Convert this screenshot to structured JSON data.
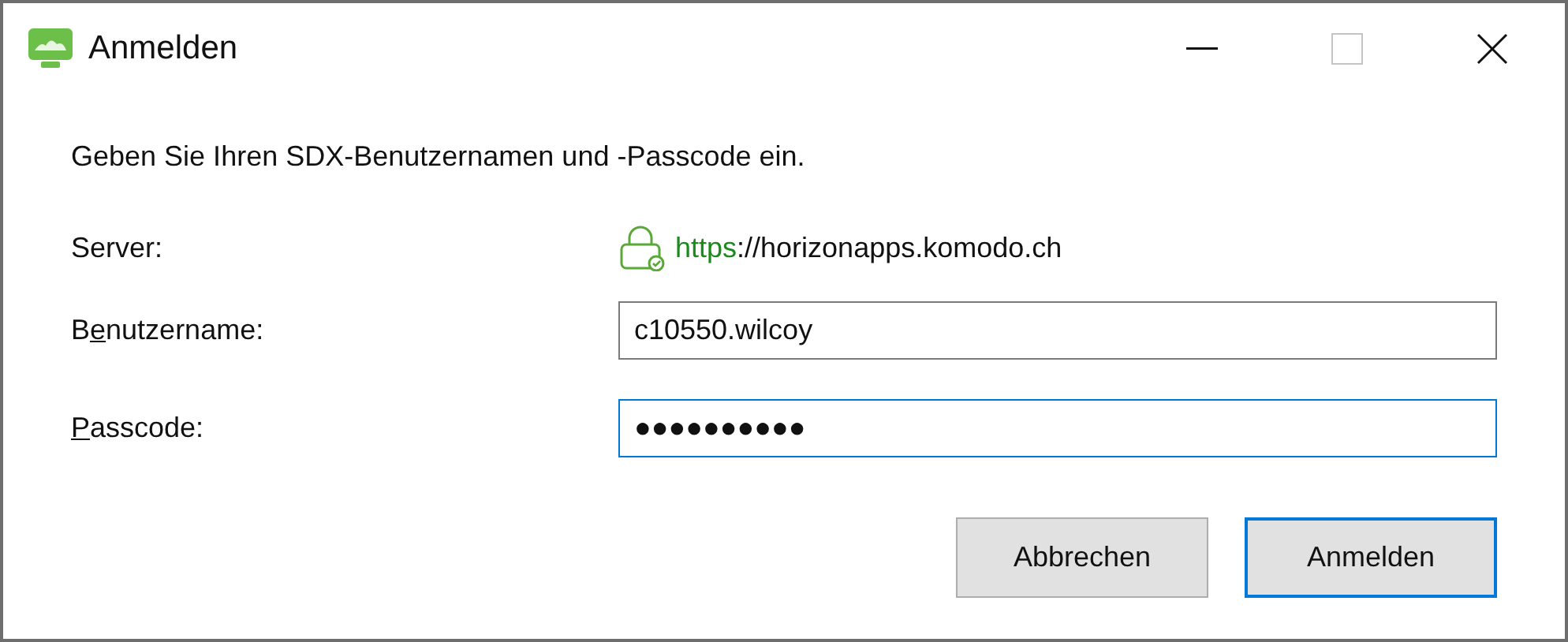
{
  "window": {
    "title": "Anmelden"
  },
  "message": "Geben Sie Ihren SDX-Benutzernamen und -Passcode ein.",
  "server": {
    "label": "Server:",
    "scheme": "https",
    "rest": "://horizonapps.komodo.ch"
  },
  "fields": [
    {
      "label_before": "B",
      "access_key": "e",
      "label_after": "nutzername:",
      "value": "c10550.wilcoy",
      "focused": false
    },
    {
      "access_key": "P",
      "label_after": "asscode:",
      "value": "●●●●●●●●●●",
      "focused": true
    }
  ],
  "buttons": [
    {
      "label": "Abbrechen",
      "default": false
    },
    {
      "label": "Anmelden",
      "default": true
    }
  ]
}
